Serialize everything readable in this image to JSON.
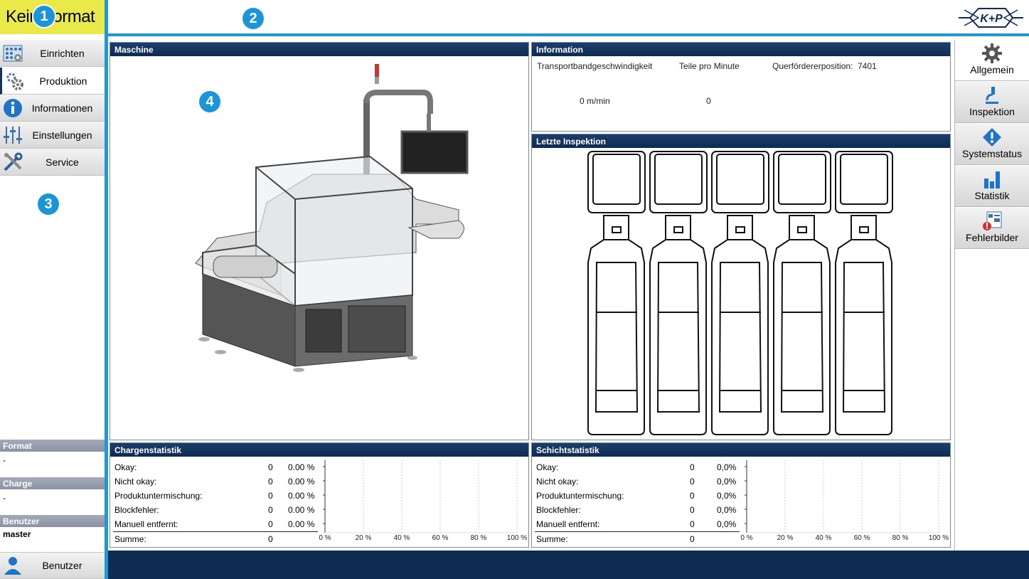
{
  "header": {
    "format_label": "Kein Format",
    "badges": [
      "1",
      "2",
      "3",
      "4"
    ],
    "logo_text": "K+P",
    "accent": "#1a9ad6"
  },
  "sidebar": {
    "items": [
      {
        "label": "Einrichten",
        "icon": "grid-gear-icon"
      },
      {
        "label": "Produktion",
        "icon": "gears-icon"
      },
      {
        "label": "Informationen",
        "icon": "info-icon"
      },
      {
        "label": "Einstellungen",
        "icon": "sliders-icon"
      },
      {
        "label": "Service",
        "icon": "tools-icon"
      }
    ],
    "active": "Produktion",
    "format_title": "Format",
    "format_value": "-",
    "charge_title": "Charge",
    "charge_value": "-",
    "user_title": "Benutzer",
    "user_value": "master",
    "user_button": "Benutzer"
  },
  "panels": {
    "machine_title": "Maschine",
    "info_title": "Information",
    "inspection_title": "Letzte Inspektion",
    "batch_title": "Chargenstatistik",
    "shift_title": "Schichtstatistik"
  },
  "information": {
    "speed_label": "Transportbandgeschwindigkeit",
    "speed_value": "0 m/min",
    "ppm_label": "Teile pro Minute",
    "ppm_value": "0",
    "cross_label": "Querfördererposition:",
    "cross_value": "7401"
  },
  "batch_stats": {
    "rows": [
      {
        "label": "Okay:",
        "count": "0",
        "pct": "0.00 %"
      },
      {
        "label": "Nicht okay:",
        "count": "0",
        "pct": "0.00 %"
      },
      {
        "label": "Produktuntermischung:",
        "count": "0",
        "pct": "0.00 %"
      },
      {
        "label": "Blockfehler:",
        "count": "0",
        "pct": "0.00 %"
      },
      {
        "label": "Manuell entfernt:",
        "count": "0",
        "pct": "0.00 %"
      }
    ],
    "sum_label": "Summe:",
    "sum_value": "0",
    "axis": [
      "0 %",
      "20 %",
      "40 %",
      "60 %",
      "80 %",
      "100 %"
    ]
  },
  "shift_stats": {
    "rows": [
      {
        "label": "Okay:",
        "count": "0",
        "pct": "0,0%"
      },
      {
        "label": "Nicht okay:",
        "count": "0",
        "pct": "0,0%"
      },
      {
        "label": "Produktuntermischung:",
        "count": "0",
        "pct": "0,0%"
      },
      {
        "label": "Blockfehler:",
        "count": "0",
        "pct": "0,0%"
      },
      {
        "label": "Manuell entfernt:",
        "count": "0",
        "pct": "0,0%"
      }
    ],
    "sum_label": "Summe:",
    "sum_value": "0",
    "axis": [
      "0 %",
      "20 %",
      "40 %",
      "60 %",
      "80 %",
      "100 %"
    ]
  },
  "right_tabs": [
    {
      "label": "Allgemein",
      "icon": "gear-icon"
    },
    {
      "label": "Inspektion",
      "icon": "microscope-icon"
    },
    {
      "label": "Systemstatus",
      "icon": "warning-diamond-icon"
    },
    {
      "label": "Statistik",
      "icon": "bar-chart-icon"
    },
    {
      "label": "Fehlerbilder",
      "icon": "error-image-icon"
    }
  ],
  "colors": {
    "format_bg": "#e9e94a",
    "panel_header": "#0e2b52",
    "badge": "#1a96d8"
  }
}
